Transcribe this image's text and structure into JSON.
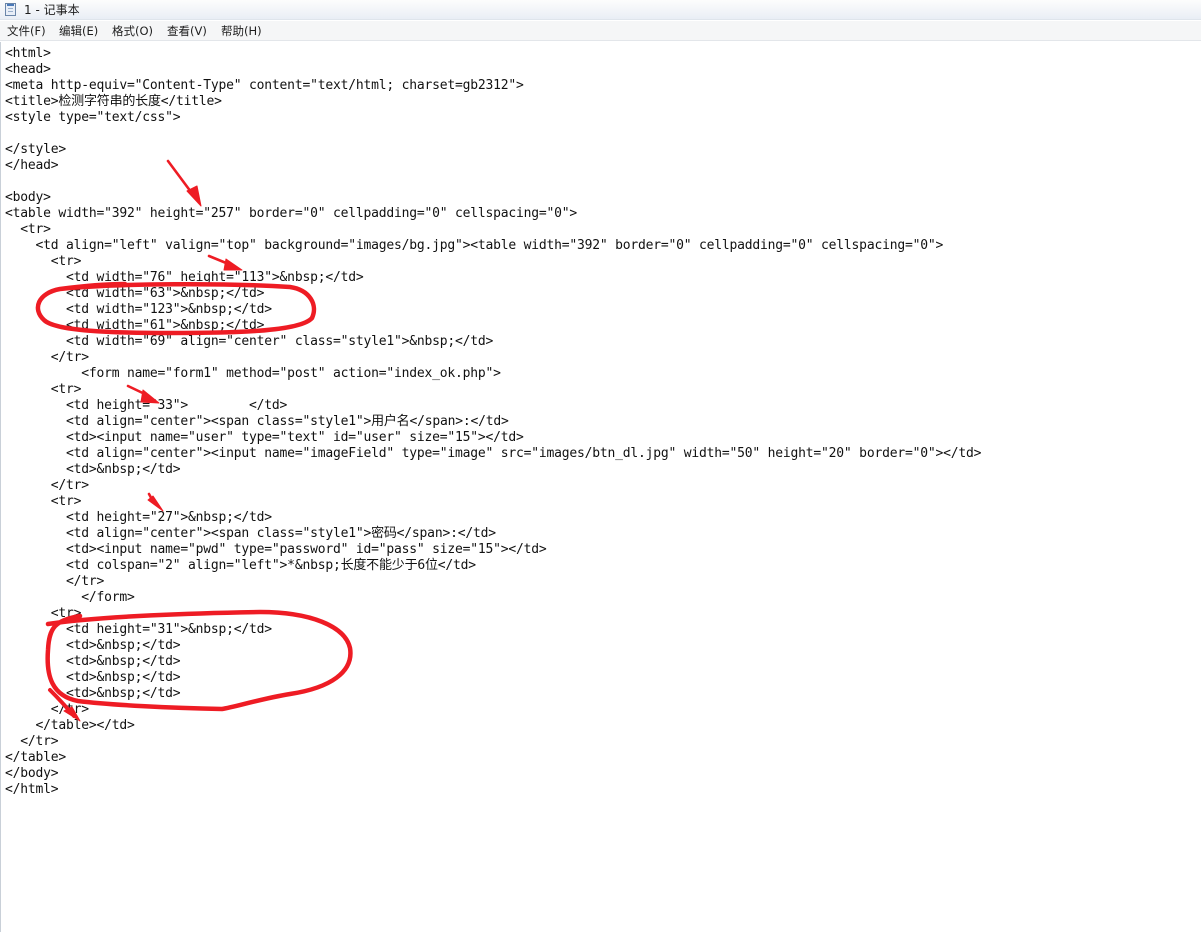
{
  "window": {
    "title": "1 - 记事本"
  },
  "menu": {
    "items": [
      "文件(F)",
      "编辑(E)",
      "格式(O)",
      "查看(V)",
      "帮助(H)"
    ]
  },
  "editor": {
    "lines": [
      "<html>",
      "<head>",
      "<meta http-equiv=\"Content-Type\" content=\"text/html; charset=gb2312\">",
      "<title>检测字符串的长度</title>",
      "<style type=\"text/css\">",
      "",
      "</style>",
      "</head>",
      "",
      "<body>",
      "<table width=\"392\" height=\"257\" border=\"0\" cellpadding=\"0\" cellspacing=\"0\">",
      "  <tr>",
      "    <td align=\"left\" valign=\"top\" background=\"images/bg.jpg\"><table width=\"392\" border=\"0\" cellpadding=\"0\" cellspacing=\"0\">",
      "      <tr>",
      "        <td width=\"76\" height=\"113\">&nbsp;</td>",
      "        <td width=\"63\">&nbsp;</td>",
      "        <td width=\"123\">&nbsp;</td>",
      "        <td width=\"61\">&nbsp;</td>",
      "        <td width=\"69\" align=\"center\" class=\"style1\">&nbsp;</td>",
      "      </tr>",
      "          <form name=\"form1\" method=\"post\" action=\"index_ok.php\">",
      "      <tr>",
      "        <td height=\"33\">        </td>",
      "        <td align=\"center\"><span class=\"style1\">用户名</span>:</td>",
      "        <td><input name=\"user\" type=\"text\" id=\"user\" size=\"15\"></td>",
      "        <td align=\"center\"><input name=\"imageField\" type=\"image\" src=\"images/btn_dl.jpg\" width=\"50\" height=\"20\" border=\"0\"></td>",
      "        <td>&nbsp;</td>",
      "      </tr>",
      "      <tr>",
      "        <td height=\"27\">&nbsp;</td>",
      "        <td align=\"center\"><span class=\"style1\">密码</span>:</td>",
      "        <td><input name=\"pwd\" type=\"password\" id=\"pass\" size=\"15\"></td>",
      "        <td colspan=\"2\" align=\"left\">*&nbsp;长度不能少于6位</td>",
      "        </tr>",
      "          </form>",
      "      <tr>",
      "        <td height=\"31\">&nbsp;</td>",
      "        <td>&nbsp;</td>",
      "        <td>&nbsp;</td>",
      "        <td>&nbsp;</td>",
      "        <td>&nbsp;</td>",
      "      </tr>",
      "    </table></td>",
      "  </tr>",
      "</table>",
      "</body>",
      "</html>"
    ]
  },
  "annotation_color": "#ee1c24"
}
